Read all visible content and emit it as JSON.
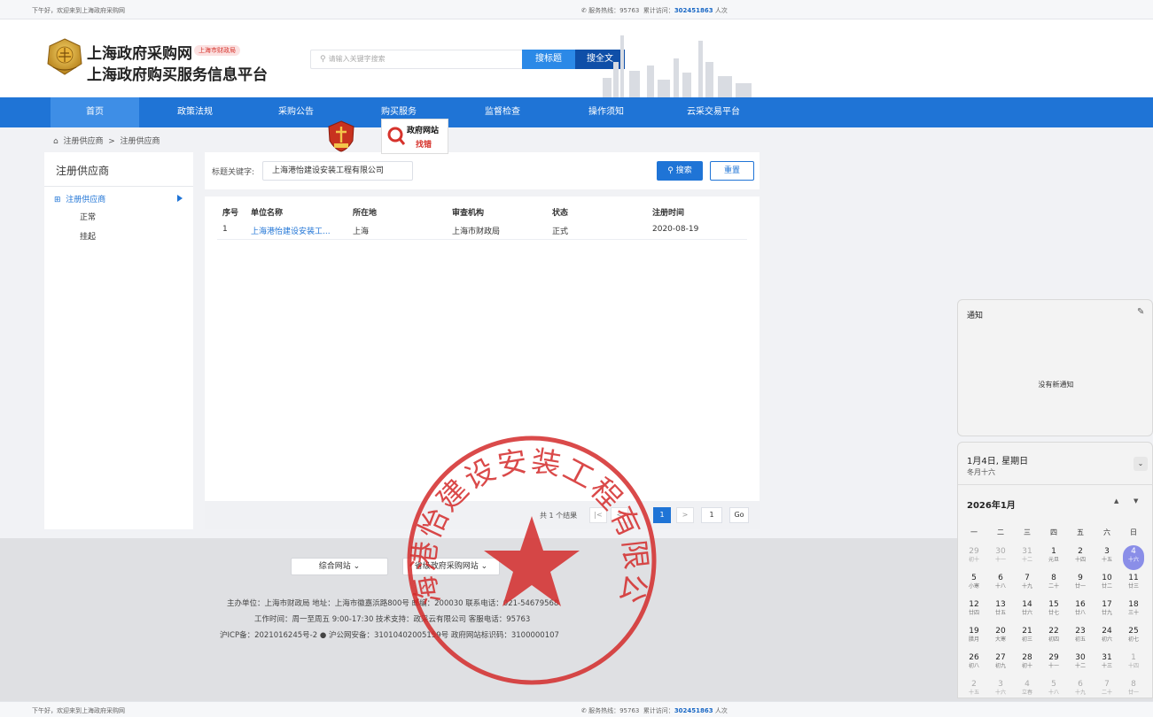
{
  "topbar": {
    "greeting": "下午好，欢迎来到上海政府采购网",
    "hotline": "✆ 服务热线：95763",
    "visits_label": "累计访问：",
    "visits": "302451863",
    "visits_unit": "人次"
  },
  "header": {
    "title1": "上海政府采购网",
    "badge": "上海市财政局",
    "title2": "上海政府购买服务信息平台",
    "search_placeholder": "请输入关键字搜索",
    "btn_title": "搜标题",
    "btn_full": "搜全文"
  },
  "nav": [
    "首页",
    "政策法规",
    "采购公告",
    "购买服务",
    "监督检查",
    "操作须知",
    "云采交易平台"
  ],
  "breadcrumb": {
    "home": "注册供应商",
    "sep": ">",
    "current": "注册供应商"
  },
  "sidebar": {
    "title": "注册供应商",
    "expand_symbol": "⊞",
    "main": "注册供应商",
    "subs": [
      "正常",
      "挂起"
    ]
  },
  "filter": {
    "label": "标题关键字:",
    "value": "上海港怡建设安装工程有限公司",
    "search_btn": "搜索",
    "reset_btn": "重置"
  },
  "table": {
    "headers": [
      "序号",
      "单位名称",
      "所在地",
      "审查机构",
      "状态",
      "注册时间"
    ],
    "rows": [
      [
        "1",
        "上海港怡建设安装工...",
        "上海",
        "上海市财政局",
        "正式",
        "2020-08-19"
      ]
    ]
  },
  "pager": {
    "total": "共 1 个结果",
    "first": "|<",
    "prev": "<",
    "current": "1",
    "next": ">",
    "input": "1",
    "go": "Go"
  },
  "footer": {
    "select1": "综合网站",
    "select2": "省级政府采购网站",
    "line1": "主办单位：上海市财政局 地址：上海市徽嘉浜路800号 邮编：200030 联系电话：021-54679568",
    "line2": "工作时间：周一至周五 9:00-17:30 技术支持：政采云有限公司 客服电话：95763",
    "line3": "沪ICP备：2021016245号-2 ● 沪公网安备：31010402005159号 政府网站标识码：3100000107",
    "jiucuo1": "政府网站",
    "jiucuo2": "找错"
  },
  "notification": {
    "title": "通知",
    "empty": "没有新通知"
  },
  "calendar": {
    "date": "1月4日, 星期日",
    "lunar": "冬月十六",
    "month": "2026年1月",
    "up": "▲",
    "down": "▼",
    "weekdays": [
      "一",
      "二",
      "三",
      "四",
      "五",
      "六",
      "日"
    ],
    "weeks": [
      [
        [
          "29",
          "初十",
          1
        ],
        [
          "30",
          "十一",
          1
        ],
        [
          "31",
          "十二",
          1
        ],
        [
          "1",
          "元旦",
          0
        ],
        [
          "2",
          "十四",
          0
        ],
        [
          "3",
          "十五",
          0
        ],
        [
          "4",
          "十六",
          2
        ]
      ],
      [
        [
          "5",
          "小寒",
          0
        ],
        [
          "6",
          "十八",
          0
        ],
        [
          "7",
          "十九",
          0
        ],
        [
          "8",
          "二十",
          0
        ],
        [
          "9",
          "廿一",
          0
        ],
        [
          "10",
          "廿二",
          0
        ],
        [
          "11",
          "廿三",
          0
        ]
      ],
      [
        [
          "12",
          "廿四",
          0
        ],
        [
          "13",
          "廿五",
          0
        ],
        [
          "14",
          "廿六",
          0
        ],
        [
          "15",
          "廿七",
          0
        ],
        [
          "16",
          "廿八",
          0
        ],
        [
          "17",
          "廿九",
          0
        ],
        [
          "18",
          "三十",
          0
        ]
      ],
      [
        [
          "19",
          "腊月",
          0
        ],
        [
          "20",
          "大寒",
          0
        ],
        [
          "21",
          "初三",
          0
        ],
        [
          "22",
          "初四",
          0
        ],
        [
          "23",
          "初五",
          0
        ],
        [
          "24",
          "初六",
          0
        ],
        [
          "25",
          "初七",
          0
        ]
      ],
      [
        [
          "26",
          "初八",
          0
        ],
        [
          "27",
          "初九",
          0
        ],
        [
          "28",
          "初十",
          0
        ],
        [
          "29",
          "十一",
          0
        ],
        [
          "30",
          "十二",
          0
        ],
        [
          "31",
          "十三",
          0
        ],
        [
          "1",
          "十四",
          1
        ]
      ],
      [
        [
          "2",
          "十五",
          1
        ],
        [
          "3",
          "十六",
          1
        ],
        [
          "4",
          "立春",
          1
        ],
        [
          "5",
          "十八",
          1
        ],
        [
          "6",
          "十九",
          1
        ],
        [
          "7",
          "二十",
          1
        ],
        [
          "8",
          "廿一",
          1
        ]
      ]
    ]
  },
  "seal": {
    "text": "上海港怡建设安装工程有限公司"
  },
  "colors": {
    "primary": "#1f74d6",
    "seal": "#d42a2a",
    "today": "#8a8ee8"
  }
}
